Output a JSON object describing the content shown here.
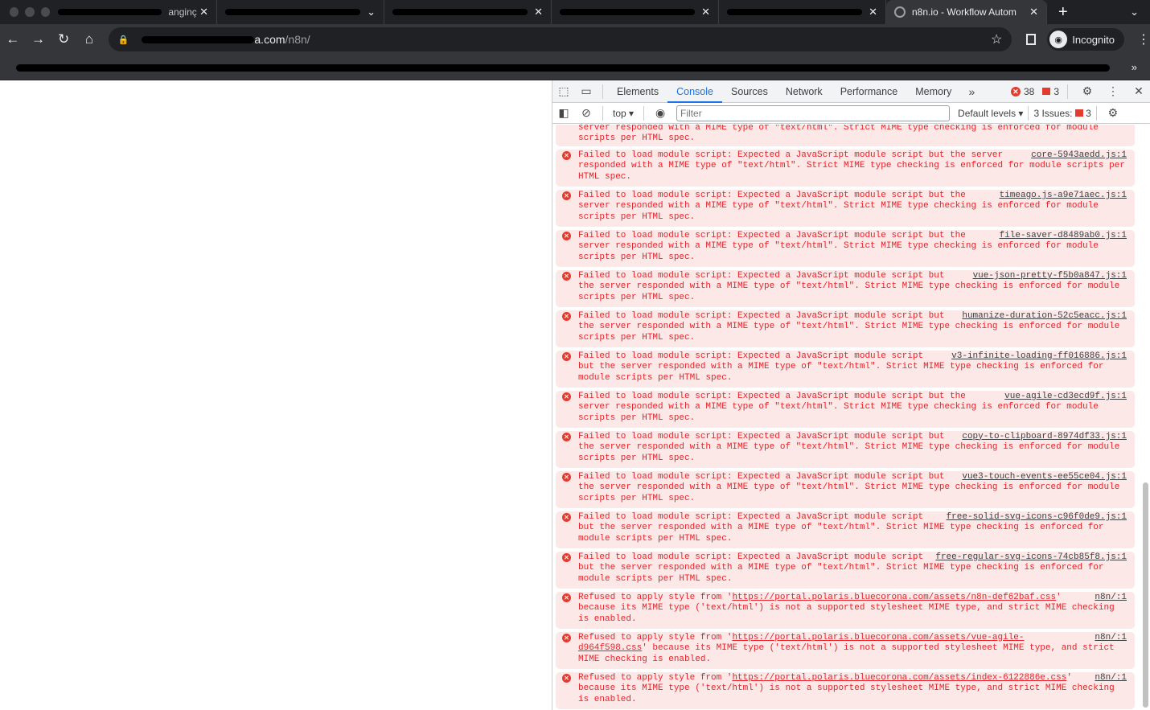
{
  "browser": {
    "tabs": [
      {
        "label": "anginç"
      },
      {
        "label": ""
      },
      {
        "label": ""
      },
      {
        "label": ""
      },
      {
        "label": ""
      },
      {
        "label": "n8n.io - Workflow Autom"
      }
    ],
    "url_visible": "a.com",
    "url_path": "/n8n/",
    "incognito_label": "Incognito"
  },
  "devtools": {
    "tabs": [
      "Elements",
      "Console",
      "Sources",
      "Network",
      "Performance",
      "Memory"
    ],
    "active_tab": "Console",
    "error_count": "38",
    "issue_flag_count": "3",
    "context": "top",
    "filter_placeholder": "Filter",
    "levels": "Default levels ▾",
    "issues_label": "3 Issues:",
    "issues_count": "3"
  },
  "console": {
    "messages": [
      {
        "text": "server responded with a MIME type of \"text/html\". Strict MIME type checking is enforced for module scripts per HTML spec.",
        "source": ""
      },
      {
        "text": "Failed to load module script: Expected a JavaScript module script but the server responded with a MIME type of \"text/html\". Strict MIME type checking is enforced for module scripts per HTML spec.",
        "source": "core-5943aedd.js:1"
      },
      {
        "text": "Failed to load module script: Expected a JavaScript module script but the server responded with a MIME type of \"text/html\". Strict MIME type checking is enforced for module scripts per HTML spec.",
        "source": "timeago.js-a9e71aec.js:1"
      },
      {
        "text": "Failed to load module script: Expected a JavaScript module script but the server responded with a MIME type of \"text/html\". Strict MIME type checking is enforced for module scripts per HTML spec.",
        "source": "file-saver-d8489ab0.js:1"
      },
      {
        "text": "Failed to load module script: Expected a JavaScript module script but the server responded with a MIME type of \"text/html\". Strict MIME type checking is enforced for module scripts per HTML spec.",
        "source": "vue-json-pretty-f5b0a847.js:1"
      },
      {
        "text": "Failed to load module script: Expected a JavaScript module script but the server responded with a MIME type of \"text/html\". Strict MIME type checking is enforced for module scripts per HTML spec.",
        "source": "humanize-duration-52c5eacc.js:1"
      },
      {
        "text": "Failed to load module script: Expected a JavaScript module script but the server responded with a MIME type of \"text/html\". Strict MIME type checking is enforced for module scripts per HTML spec.",
        "source": "v3-infinite-loading-ff016886.js:1"
      },
      {
        "text": "Failed to load module script: Expected a JavaScript module script but the server responded with a MIME type of \"text/html\". Strict MIME type checking is enforced for module scripts per HTML spec.",
        "source": "vue-agile-cd3ecd9f.js:1"
      },
      {
        "text": "Failed to load module script: Expected a JavaScript module script but the server responded with a MIME type of \"text/html\". Strict MIME type checking is enforced for module scripts per HTML spec.",
        "source": "copy-to-clipboard-8974df33.js:1"
      },
      {
        "text": "Failed to load module script: Expected a JavaScript module script but the server responded with a MIME type of \"text/html\". Strict MIME type checking is enforced for module scripts per HTML spec.",
        "source": "vue3-touch-events-ee55ce04.js:1"
      },
      {
        "text": "Failed to load module script: Expected a JavaScript module script but the server responded with a MIME type of \"text/html\". Strict MIME type checking is enforced for module scripts per HTML spec.",
        "source": "free-solid-svg-icons-c96f0de9.js:1"
      },
      {
        "text": "Failed to load module script: Expected a JavaScript module script but the server responded with a MIME type of \"text/html\". Strict MIME type checking is enforced for module scripts per HTML spec.",
        "source": "free-regular-svg-icons-74cb85f8.js:1"
      }
    ],
    "style_errors": [
      {
        "prefix": "Refused to apply style from '",
        "url": "https://portal.polaris.bluecorona.com/assets/n8n-def62baf.css",
        "suffix": "' because its MIME type ('text/html') is not a supported stylesheet MIME type, and strict MIME checking is enabled.",
        "source": "n8n/:1"
      },
      {
        "prefix": "Refused to apply style from '",
        "url": "https://portal.polaris.bluecorona.com/assets/vue-agile-d964f598.css",
        "suffix": "' because its MIME type ('text/html') is not a supported stylesheet MIME type, and strict MIME checking is enabled.",
        "source": "n8n/:1"
      },
      {
        "prefix": "Refused to apply style from '",
        "url": "https://portal.polaris.bluecorona.com/assets/index-6122886e.css",
        "suffix": "' because its MIME type ('text/html') is not a supported stylesheet MIME type, and strict MIME checking is enabled.",
        "source": "n8n/:1"
      }
    ],
    "prompt": "›"
  },
  "colors": {
    "error_text": "#e8222a",
    "error_bg": "#fce8e6",
    "accent": "#1a73e8"
  }
}
